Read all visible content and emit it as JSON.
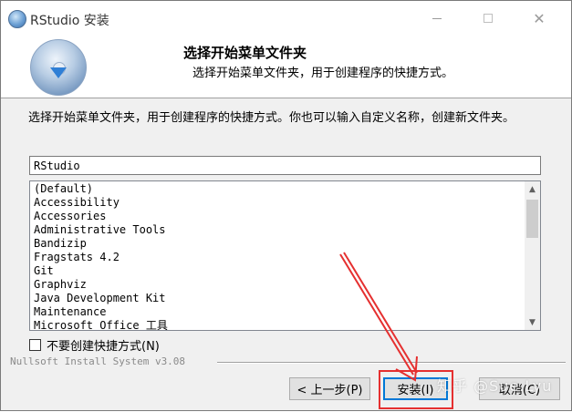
{
  "window": {
    "title": "RStudio 安装"
  },
  "header": {
    "title": "选择开始菜单文件夹",
    "subtitle": "选择开始菜单文件夹，用于创建程序的快捷方式。"
  },
  "body": {
    "description": "选择开始菜单文件夹，用于创建程序的快捷方式。你也可以输入自定义名称，创建新文件夹。",
    "folder_value": "RStudio",
    "folders": [
      "(Default)",
      "Accessibility",
      "Accessories",
      "Administrative Tools",
      "Bandizip",
      "Fragstats 4.2",
      "Git",
      "Graphviz",
      "Java Development Kit",
      "Maintenance",
      "Microsoft Office 工具"
    ],
    "no_shortcut_label": "不要创建快捷方式(N)",
    "no_shortcut_checked": false
  },
  "footer": {
    "branding": "Nullsoft Install System v3.08",
    "back_label": "< 上一步(P)",
    "install_label": "安装(I)",
    "cancel_label": "取消(C)"
  },
  "overlay": {
    "watermark": "知乎 @Sue.Lyu",
    "highlight_color": "#e53030"
  }
}
